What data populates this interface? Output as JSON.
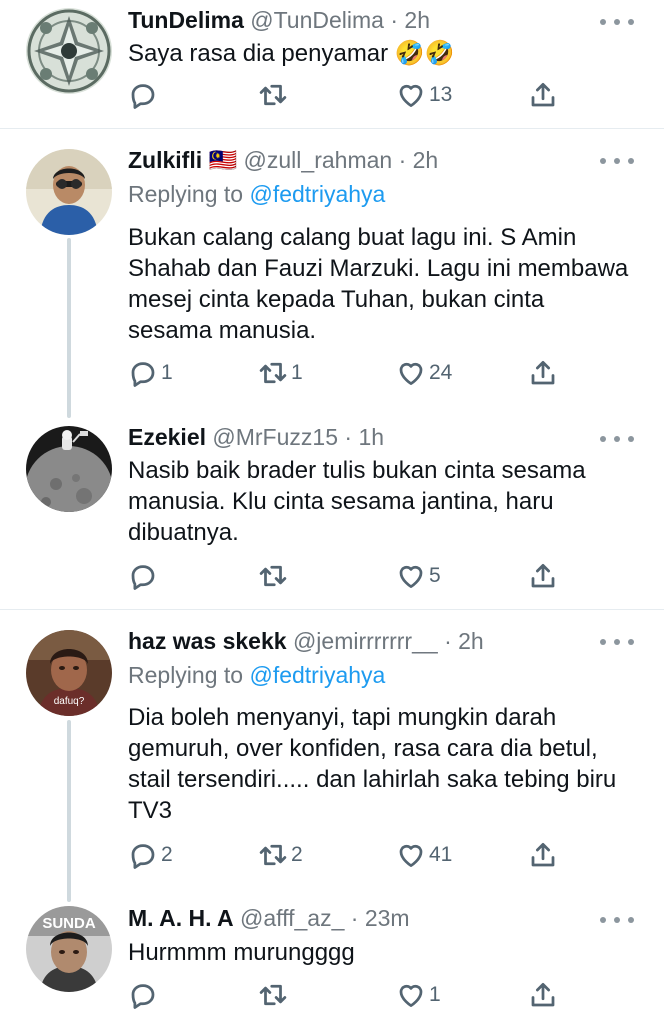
{
  "tweets": [
    {
      "name": "TunDelima",
      "flag": "",
      "handle": "@TunDelima",
      "time": "2h",
      "replying_prefix": "",
      "replying_to": "",
      "text": "Saya rasa dia penyamar 🤣🤣",
      "replies": "",
      "retweets": "",
      "likes": "13"
    },
    {
      "name": "Zulkifli",
      "flag": "🇲🇾",
      "handle": "@zull_rahman",
      "time": "2h",
      "replying_prefix": "Replying to",
      "replying_to": "@fedtriyahya",
      "text": "Bukan calang calang buat lagu ini. S Amin Shahab dan Fauzi Marzuki. Lagu ini membawa mesej cinta kepada Tuhan, bukan cinta sesama manusia.",
      "replies": "1",
      "retweets": "1",
      "likes": "24"
    },
    {
      "name": "Ezekiel",
      "flag": "",
      "handle": "@MrFuzz15",
      "time": "1h",
      "replying_prefix": "",
      "replying_to": "",
      "text": "Nasib baik brader tulis bukan cinta sesama manusia. Klu cinta sesama jantina, haru dibuatnya.",
      "replies": "",
      "retweets": "",
      "likes": "5"
    },
    {
      "name": "haz was skekk",
      "flag": "",
      "handle": "@jemirrrrrrr__",
      "time": "2h",
      "replying_prefix": "Replying to",
      "replying_to": "@fedtriyahya",
      "text": "Dia boleh menyanyi, tapi mungkin darah gemuruh, over konfiden, rasa cara dia betul, stail tersendiri..... dan lahirlah saka tebing biru TV3",
      "replies": "2",
      "retweets": "2",
      "likes": "41",
      "avatar_text": "dafuq?"
    },
    {
      "name": "M. A. H. A",
      "flag": "",
      "handle": "@afff_az_",
      "time": "23m",
      "replying_prefix": "",
      "replying_to": "",
      "text": "Hurmmm murungggg",
      "replies": "",
      "retweets": "",
      "likes": "1",
      "avatar_text": "SUNDA"
    }
  ],
  "separator": "·",
  "colors": {
    "link": "#1d9bf0",
    "meta": "#6e767d",
    "icon": "#536471",
    "divider": "#e6ecf0"
  },
  "icons": {
    "reply": "reply-icon",
    "retweet": "retweet-icon",
    "like": "heart-icon",
    "share": "share-icon",
    "more": "more-icon"
  }
}
